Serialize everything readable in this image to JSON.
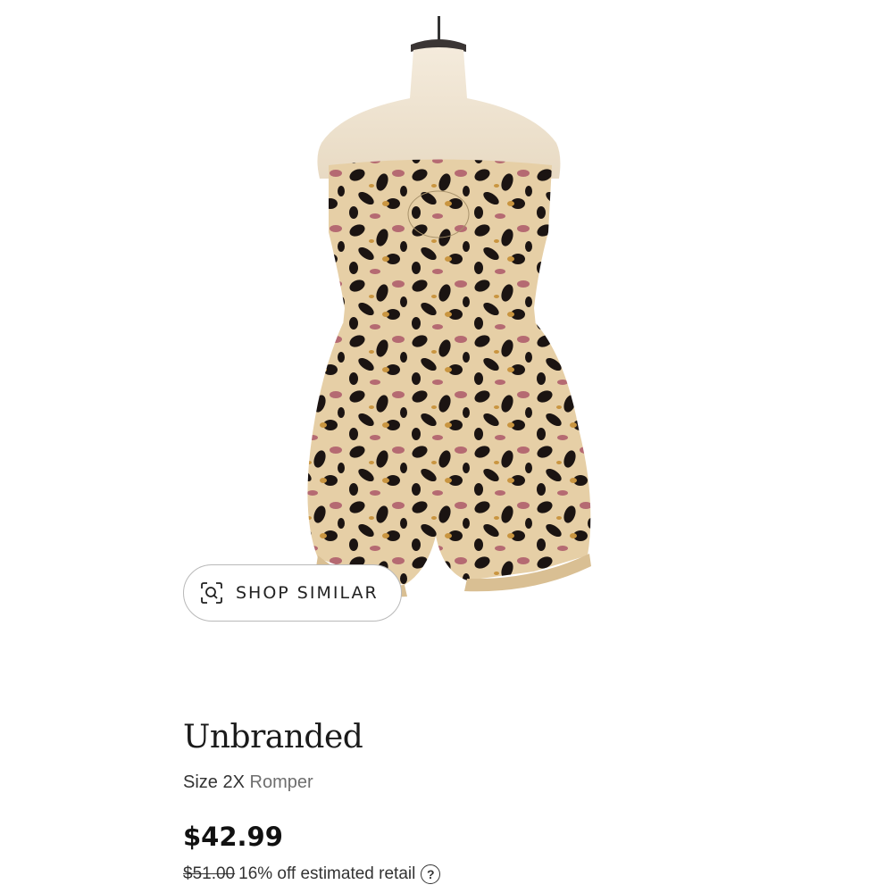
{
  "product": {
    "brand": "Unbranded",
    "size_text": "Size 2X",
    "category": "Romper",
    "price": "$42.99",
    "original_price": "$51.00",
    "discount_text": "16% off estimated retail",
    "help_glyph": "?"
  },
  "shop_similar": {
    "label": "SHOP SIMILAR",
    "icon": "visual-search-icon"
  },
  "colors": {
    "print_base": "#e6cfa6",
    "print_spot": "#1b1412",
    "print_pink": "#b56a72",
    "print_gold": "#c99540",
    "mannequin": "#f1e7d7",
    "button_border": "#b9b9b9"
  }
}
